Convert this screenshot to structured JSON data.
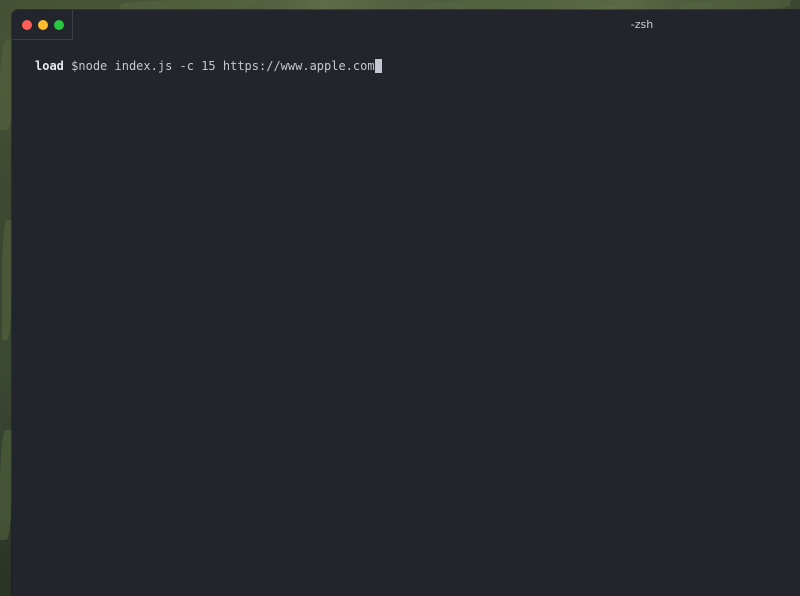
{
  "window": {
    "title": "-zsh"
  },
  "terminal": {
    "prompt_name": "load",
    "prompt_symbol": "$",
    "command": "node index.js -c 15 https://www.apple.com"
  },
  "colors": {
    "terminal_background": "#22252c",
    "text": "#c3c7cf",
    "close": "#ff5f57",
    "minimize": "#febc2e",
    "zoom": "#28c840"
  },
  "icons": {
    "close": "close-dot-icon",
    "minimize": "minimize-dot-icon",
    "zoom": "zoom-dot-icon"
  }
}
